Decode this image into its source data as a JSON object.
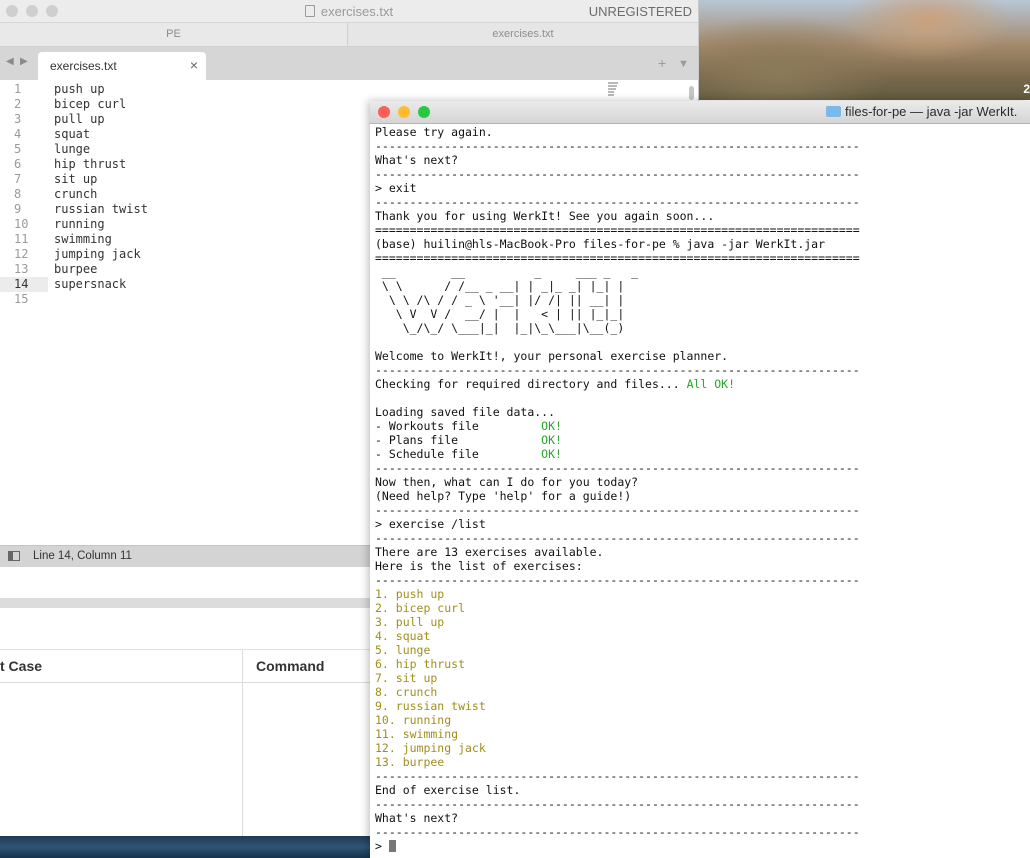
{
  "sublime": {
    "title": "exercises.txt",
    "unregistered": "UNREGISTERED",
    "groups": [
      "PE",
      "exercises.txt"
    ],
    "tab_label": "exercises.txt",
    "tab_close": "×",
    "nav_back": "◀",
    "nav_forward": "▶",
    "new_tab": "+",
    "tab_menu": "▼",
    "lines": [
      "push up",
      "bicep curl",
      "pull up",
      "squat",
      "lunge",
      "hip thrust",
      "sit up",
      "crunch",
      "russian twist",
      "running",
      "swimming",
      "jumping jack",
      "burpee",
      "supersnack",
      ""
    ],
    "line_numbers": [
      "1",
      "2",
      "3",
      "4",
      "5",
      "6",
      "7",
      "8",
      "9",
      "10",
      "11",
      "12",
      "13",
      "14",
      "15"
    ],
    "current_line": 14,
    "status": "Line 14, Column 11"
  },
  "background_table": {
    "col1": "t Case",
    "col2": "Command"
  },
  "desktop": {
    "clock_fragment": "2"
  },
  "terminal": {
    "title": "files-for-pe — java -jar WerkIt.",
    "traffic_colors": [
      "#fc5f57",
      "#fdbc2e",
      "#28c840"
    ],
    "lines": [
      "Please try again.",
      "----------------------------------------------------------------------",
      "What's next?",
      "----------------------------------------------------------------------",
      "> exit",
      "----------------------------------------------------------------------",
      "Thank you for using WerkIt! See you again soon...",
      "======================================================================",
      "(base) huilin@hls-MacBook-Pro files-for-pe % java -jar WerkIt.jar",
      "======================================================================",
      " __        __          _     ___ _   _ ",
      " \\ \\      / /__ _ __| | _|_ _| |_| |",
      "  \\ \\ /\\ / / _ \\ '__| |/ /| || __| |",
      "   \\ V  V /  __/ |  |   < | || |_|_|",
      "    \\_/\\_/ \\___|_|  |_|\\_\\___|\\__(_)",
      "",
      "Welcome to WerkIt!, your personal exercise planner.",
      "----------------------------------------------------------------------",
      "Checking for required directory and files... ",
      "",
      "Loading saved file data...",
      "- Workouts file         ",
      "- Plans file            ",
      "- Schedule file         ",
      "----------------------------------------------------------------------",
      "Now then, what can I do for you today?",
      "(Need help? Type 'help' for a guide!)",
      "----------------------------------------------------------------------",
      "> exercise /list",
      "----------------------------------------------------------------------",
      "There are 13 exercises available.",
      "Here is the list of exercises:",
      "----------------------------------------------------------------------",
      "1. push up",
      "2. bicep curl",
      "3. pull up",
      "4. squat",
      "5. lunge",
      "6. hip thrust",
      "7. sit up",
      "8. crunch",
      "9. russian twist",
      "10. running",
      "11. swimming",
      "12. jumping jack",
      "13. burpee",
      "----------------------------------------------------------------------",
      "End of exercise list.",
      "----------------------------------------------------------------------",
      "What's next?",
      "----------------------------------------------------------------------",
      "> "
    ],
    "ok_suffix": {
      "18": "All OK!",
      "21": "OK!",
      "22": "OK!",
      "23": "OK!"
    },
    "list_lines": [
      33,
      34,
      35,
      36,
      37,
      38,
      39,
      40,
      41,
      42,
      43,
      44,
      45
    ],
    "ok_color": "#2aa52a",
    "list_color": "#a08f1c"
  }
}
